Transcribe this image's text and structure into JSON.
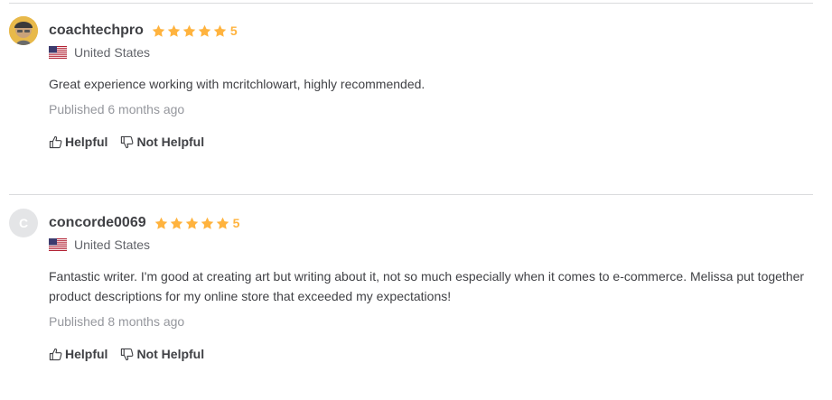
{
  "colors": {
    "star": "#ffb33e",
    "text": "#404145",
    "muted": "#95979d",
    "divider": "#dadbdd"
  },
  "reviews": [
    {
      "avatar": "user-photo",
      "username": "coachtechpro",
      "stars": 5,
      "rating": "5",
      "country_flag_icon": "us-flag-icon",
      "country": "United States",
      "text": "Great experience working with mcritchlowart, highly recommended.",
      "published": "Published 6 months ago",
      "helpful_label": "Helpful",
      "not_helpful_label": "Not Helpful"
    },
    {
      "avatar_initial": "C",
      "username": "concorde0069",
      "stars": 5,
      "rating": "5",
      "country_flag_icon": "us-flag-icon",
      "country": "United States",
      "text": "Fantastic writer. I'm good at creating art but writing about it, not so much especially when it comes to e-commerce. Melissa put together product descriptions for my online store that exceeded my expectations!",
      "published": "Published 8 months ago",
      "helpful_label": "Helpful",
      "not_helpful_label": "Not Helpful"
    }
  ]
}
